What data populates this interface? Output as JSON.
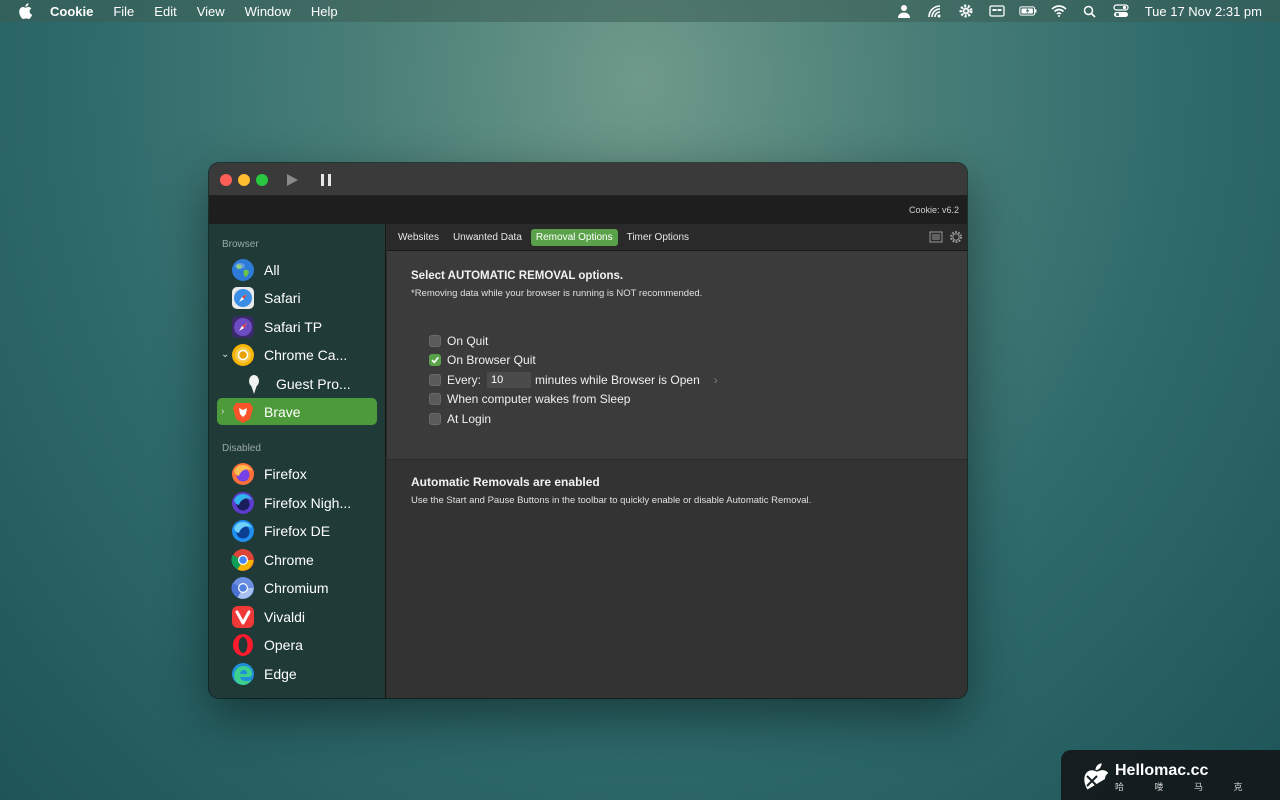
{
  "menubar": {
    "app_name": "Cookie",
    "items": [
      "File",
      "Edit",
      "View",
      "Window",
      "Help"
    ],
    "clock": "Tue 17 Nov  2:31 pm"
  },
  "window": {
    "version": "Cookie: v6.2",
    "tabs": [
      "Websites",
      "Unwanted Data",
      "Removal Options",
      "Timer Options"
    ],
    "active_tab": "Removal Options"
  },
  "sidebar": {
    "section_browser": "Browser",
    "section_disabled": "Disabled",
    "browser_items": [
      {
        "label": "All",
        "icon": "globe-icon"
      },
      {
        "label": "Safari",
        "icon": "safari-icon"
      },
      {
        "label": "Safari TP",
        "icon": "safari-tp-icon"
      },
      {
        "label": "Chrome Ca...",
        "icon": "chrome-canary-icon"
      },
      {
        "label": "Guest Pro...",
        "icon": "guest-profile-icon"
      },
      {
        "label": "Brave",
        "icon": "brave-icon"
      }
    ],
    "disabled_items": [
      {
        "label": "Firefox",
        "icon": "firefox-icon"
      },
      {
        "label": "Firefox Nigh...",
        "icon": "firefox-nightly-icon"
      },
      {
        "label": "Firefox DE",
        "icon": "firefox-de-icon"
      },
      {
        "label": "Chrome",
        "icon": "chrome-icon"
      },
      {
        "label": "Chromium",
        "icon": "chromium-icon"
      },
      {
        "label": "Vivaldi",
        "icon": "vivaldi-icon"
      },
      {
        "label": "Opera",
        "icon": "opera-icon"
      },
      {
        "label": "Edge",
        "icon": "edge-icon"
      }
    ]
  },
  "removal": {
    "heading": "Select AUTOMATIC REMOVAL options.",
    "note": "*Removing data while your browser is running is NOT recommended.",
    "options": {
      "on_quit": {
        "label": "On Quit",
        "checked": false
      },
      "on_browser_quit": {
        "label": "On Browser Quit",
        "checked": true
      },
      "every_prefix": "Every:",
      "every_value": "10",
      "every_suffix": "minutes while Browser is Open",
      "wakes": {
        "label": "When computer wakes from Sleep",
        "checked": false
      },
      "at_login": {
        "label": "At Login",
        "checked": false
      }
    },
    "status_heading": "Automatic Removals are enabled",
    "status_text": "Use the Start and Pause Buttons in the toolbar to quickly enable or disable Automatic Removal."
  },
  "watermark": {
    "title": "Hellomac.cc",
    "subtitle": "哈 喽 马 克"
  },
  "colors": {
    "accent_green": "#5aa24a",
    "selected_row": "#4d9a3a"
  }
}
